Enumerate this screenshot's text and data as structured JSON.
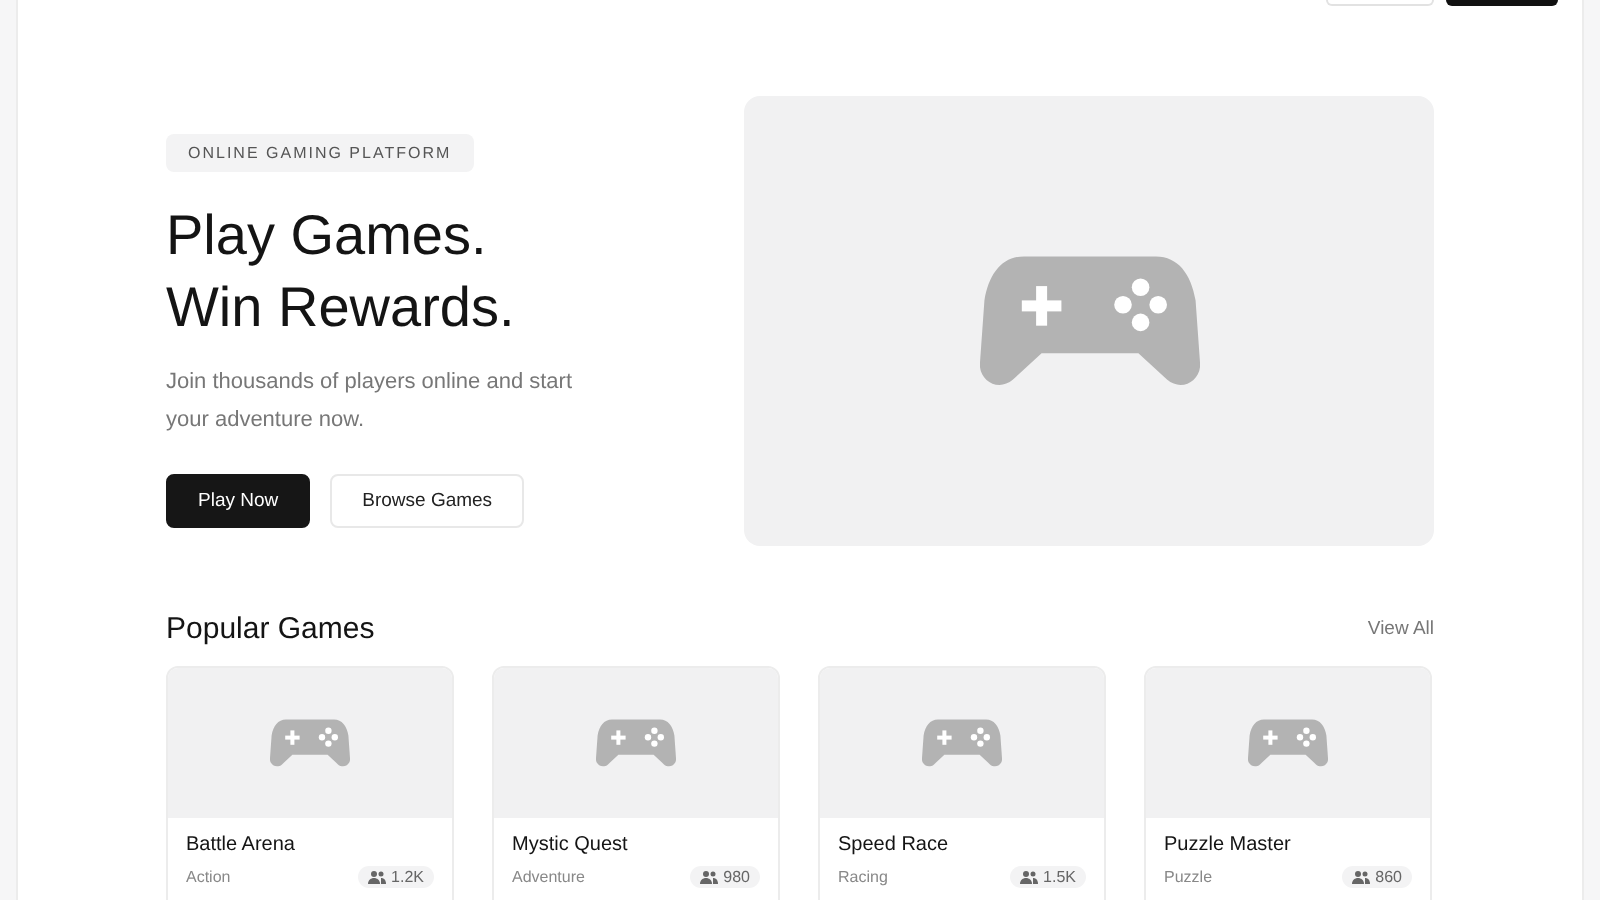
{
  "hero": {
    "badge": "ONLINE GAMING PLATFORM",
    "title_lines": [
      "Play Games.",
      "Win Rewards."
    ],
    "subtitle": "Join thousands of players online and start your adventure now.",
    "buttons": [
      {
        "label": "Play Now",
        "kind": "primary"
      },
      {
        "label": "Browse Games",
        "kind": "secondary"
      }
    ],
    "image": {
      "kind": "placeholder"
    }
  },
  "popular": {
    "title": "Popular Games",
    "link": "View All",
    "games": [
      {
        "name": "Battle Arena",
        "genre": "Action",
        "players": "1.2K"
      },
      {
        "name": "Mystic Quest",
        "genre": "Adventure",
        "players": "980"
      },
      {
        "name": "Speed Race",
        "genre": "Racing",
        "players": "1.5K"
      },
      {
        "name": "Puzzle Master",
        "genre": "Puzzle",
        "players": "860"
      }
    ]
  }
}
